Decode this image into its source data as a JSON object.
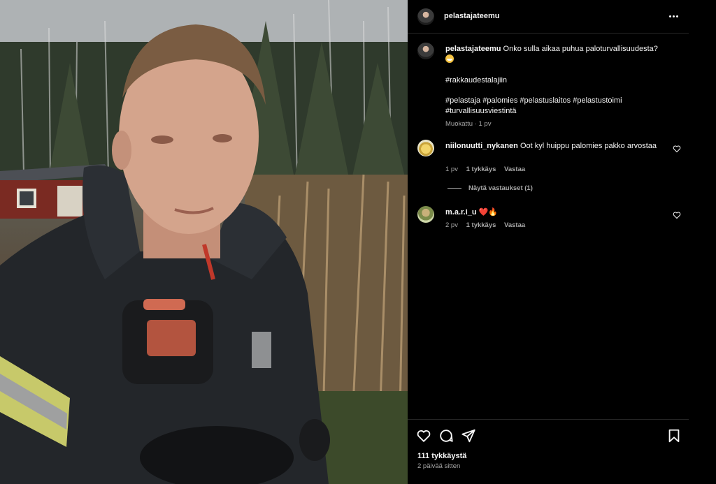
{
  "post": {
    "author": "pelastajateemu",
    "caption": {
      "text": "Onko sulla aikaa puhua paloturvallisuudesta?",
      "emoji": "grinning-face",
      "hashtag_line1": "#rakkaudestalajiin",
      "hashtag_line2": "#pelastaja #palomies #pelastuslaitos #pelastustoimi",
      "hashtag_line3": "#turvallisuusviestintä",
      "edited_label": "Muokattu",
      "age": "1 pv"
    },
    "comments": [
      {
        "author": "niilonuutti_nykanen",
        "text": "Oot kyl huippu palomies pakko arvostaa",
        "age": "1 pv",
        "likes": "1 tykkäys",
        "reply_label": "Vastaa",
        "view_replies": "Näytä vastaukset (1)"
      },
      {
        "author": "m.a.r.i_u",
        "text": "❤️🔥",
        "age": "2 pv",
        "likes": "1 tykkäys",
        "reply_label": "Vastaa"
      }
    ],
    "like_count": "111 tykkäystä",
    "posted": "2 päivää sitten"
  },
  "icons": {
    "more": "more-options-icon",
    "like": "heart-icon",
    "comment": "comment-icon",
    "share": "share-icon",
    "save": "bookmark-icon"
  },
  "colors": {
    "background": "#000000",
    "text": "#f5f5f5",
    "muted": "#a8a8a8",
    "divider": "#262626"
  }
}
